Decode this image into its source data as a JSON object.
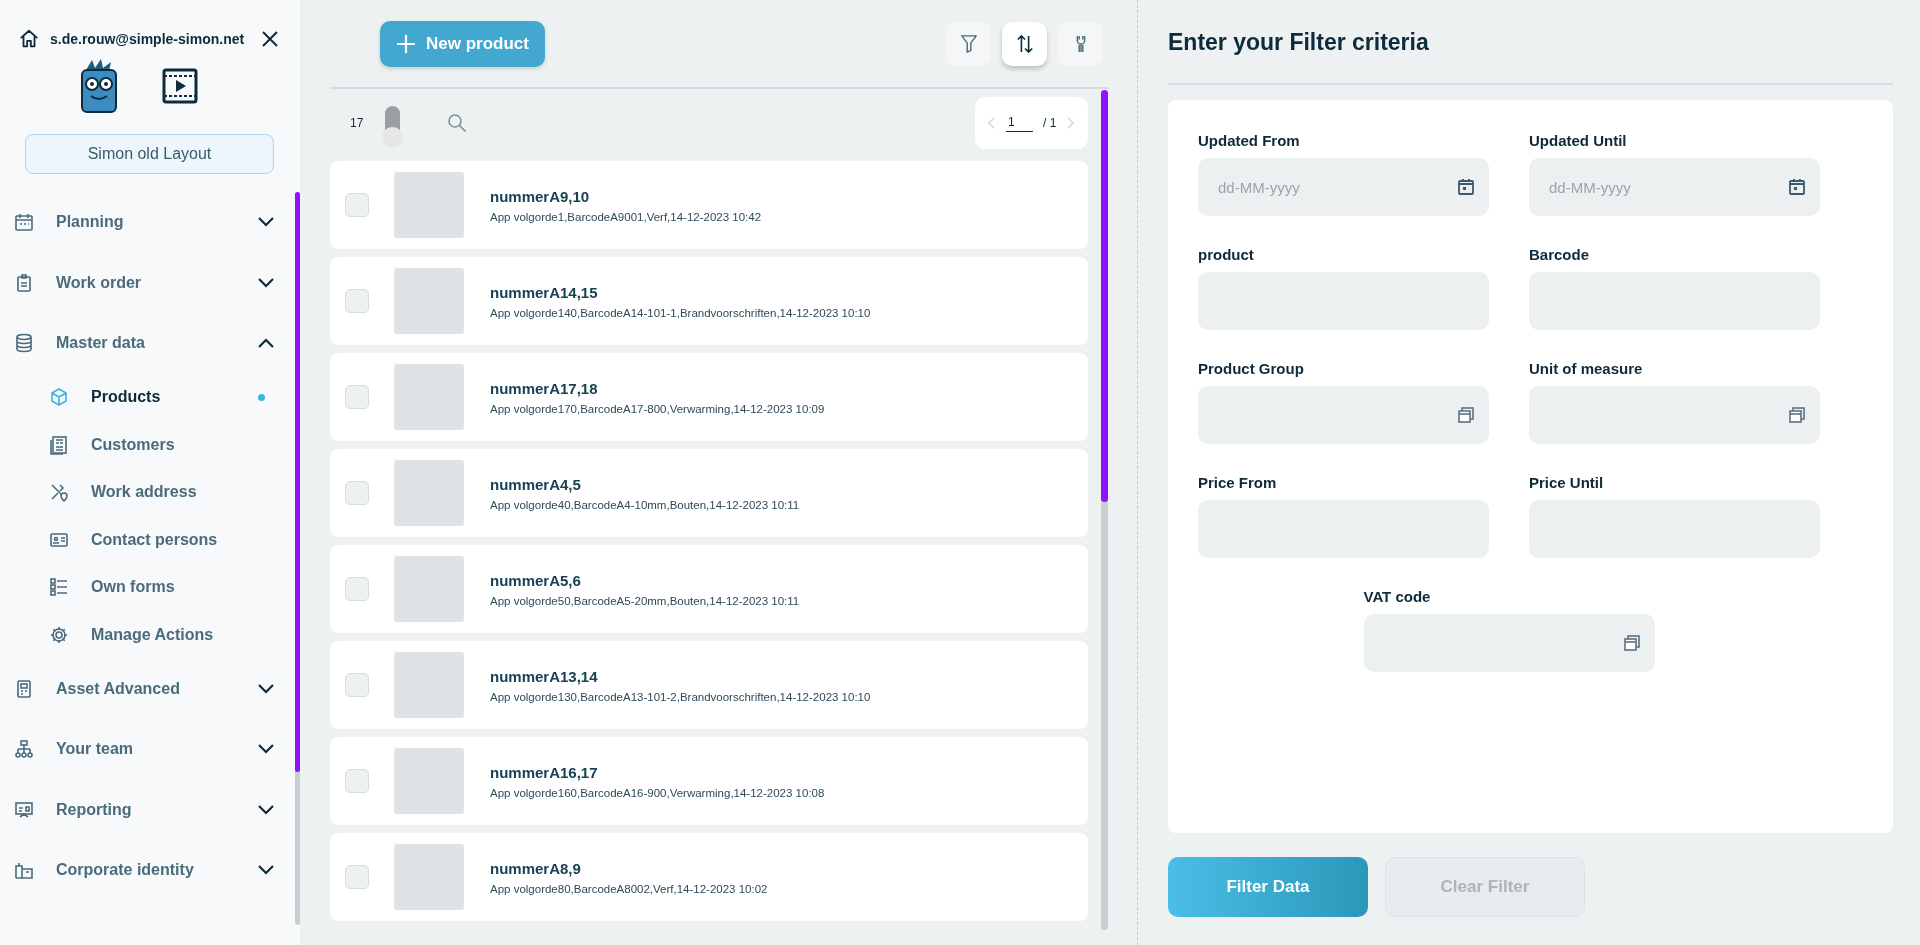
{
  "user": {
    "email": "s.de.rouw@simple-simon.net"
  },
  "layout_button": "Simon old Layout",
  "nav": [
    {
      "label": "Planning",
      "expanded": false
    },
    {
      "label": "Work order",
      "expanded": false
    },
    {
      "label": "Master data",
      "expanded": true,
      "children": [
        {
          "label": "Products",
          "selected": true
        },
        {
          "label": "Customers",
          "selected": false
        },
        {
          "label": "Work address",
          "selected": false
        },
        {
          "label": "Contact persons",
          "selected": false
        },
        {
          "label": "Own forms",
          "selected": false
        },
        {
          "label": "Manage Actions",
          "selected": false
        }
      ]
    },
    {
      "label": "Asset Advanced",
      "expanded": false
    },
    {
      "label": "Your team",
      "expanded": false
    },
    {
      "label": "Reporting",
      "expanded": false
    },
    {
      "label": "Corporate identity",
      "expanded": false
    }
  ],
  "new_product_button": "New product",
  "toolbar": [
    {
      "kind": "filter",
      "selected": false
    },
    {
      "kind": "sort",
      "selected": true
    },
    {
      "kind": "wrench",
      "selected": false
    }
  ],
  "list_toolbar": {
    "count": "17",
    "toggle_on": false,
    "page": "1",
    "page_total": "/ 1"
  },
  "products": [
    {
      "title": "nummerA9,10",
      "details": "App volgorde1,BarcodeA9001,Verf,14-12-2023 10:42",
      "checked": false
    },
    {
      "title": "nummerA14,15",
      "details": "App volgorde140,BarcodeA14-101-1,Brandvoorschriften,14-12-2023 10:10",
      "checked": false
    },
    {
      "title": "nummerA17,18",
      "details": "App volgorde170,BarcodeA17-800,Verwarming,14-12-2023 10:09",
      "checked": false
    },
    {
      "title": "nummerA4,5",
      "details": "App volgorde40,BarcodeA4-10mm,Bouten,14-12-2023 10:11",
      "checked": false
    },
    {
      "title": "nummerA5,6",
      "details": "App volgorde50,BarcodeA5-20mm,Bouten,14-12-2023 10:11",
      "checked": false
    },
    {
      "title": "nummerA13,14",
      "details": "App volgorde130,BarcodeA13-101-2,Brandvoorschriften,14-12-2023 10:10",
      "checked": false
    },
    {
      "title": "nummerA16,17",
      "details": "App volgorde160,BarcodeA16-900,Verwarming,14-12-2023 10:08",
      "checked": false
    },
    {
      "title": "nummerA8,9",
      "details": "App volgorde80,BarcodeA8002,Verf,14-12-2023 10:02",
      "checked": false
    }
  ],
  "filter": {
    "title": "Enter your Filter criteria",
    "fields": [
      {
        "label": "Updated From",
        "kind": "date",
        "placeholder": "dd-MM-yyyy"
      },
      {
        "label": "Updated Until",
        "kind": "date",
        "placeholder": "dd-MM-yyyy"
      },
      {
        "label": "product",
        "kind": "text"
      },
      {
        "label": "Barcode",
        "kind": "text"
      },
      {
        "label": "Product Group",
        "kind": "lookup"
      },
      {
        "label": "Unit of measure",
        "kind": "lookup"
      },
      {
        "label": "Price From",
        "kind": "text"
      },
      {
        "label": "Price Until",
        "kind": "text"
      },
      {
        "label": "VAT code",
        "kind": "lookup"
      }
    ],
    "buttons": [
      {
        "label": "Filter Data",
        "disabled": false
      },
      {
        "label": "Clear Filter",
        "disabled": true
      }
    ]
  }
}
